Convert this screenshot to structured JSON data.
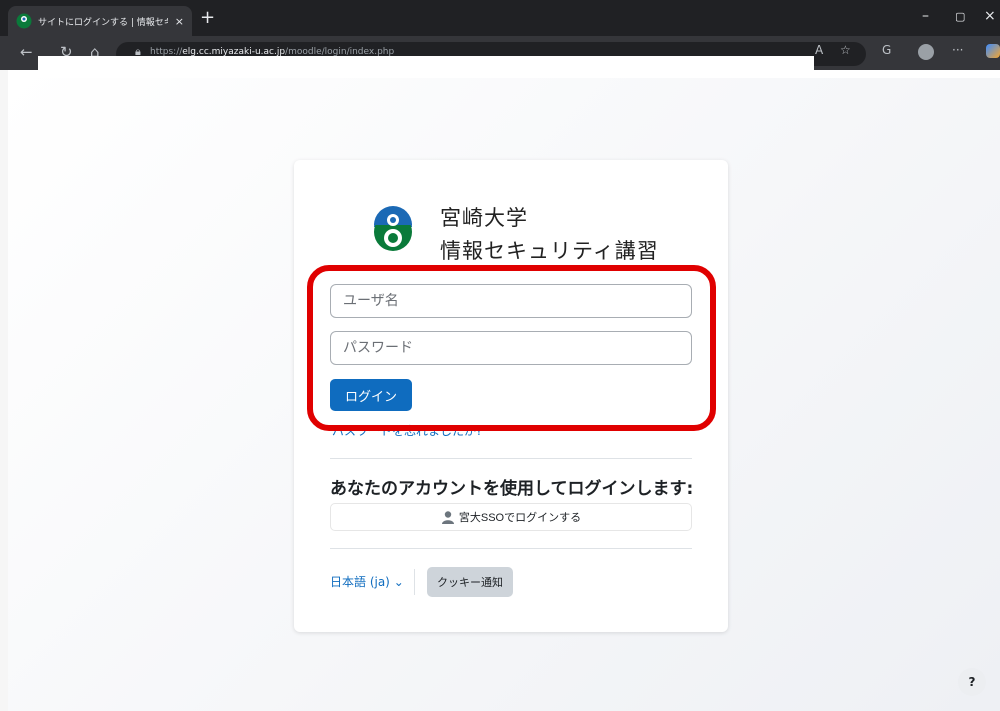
{
  "browser": {
    "tab_title": "サイトにログインする | 情報セキュリティ講",
    "new_tab": "+",
    "tab_close": "×",
    "url_prefix": "https://",
    "url_host": "elg.cc.miyazaki-u.ac.jp",
    "url_path": "/moodle/login/index.php",
    "win_minimize": "–",
    "win_maximize": "▢",
    "win_close": "×",
    "more": "···"
  },
  "logo": {
    "line1": "宮崎大学",
    "line2": "情報セキュリティ講習",
    "colors": {
      "green": "#0a7a3a",
      "blue": "#1b69b5"
    }
  },
  "form": {
    "username_placeholder": "ユーザ名",
    "password_placeholder": "パスワード",
    "login_label": "ログイン",
    "forgot_label": "パスワードを忘れましたか?"
  },
  "sso": {
    "heading": "あなたのアカウントを使用してログインします:",
    "button_label": "宮大SSOでログインする"
  },
  "footer": {
    "language": "日本語 (ja)",
    "language_caret": "⌄",
    "cookie_label": "クッキー通知"
  },
  "help": {
    "label": "?"
  },
  "colors": {
    "primary": "#0f6cbf",
    "highlight": "#e00000"
  }
}
